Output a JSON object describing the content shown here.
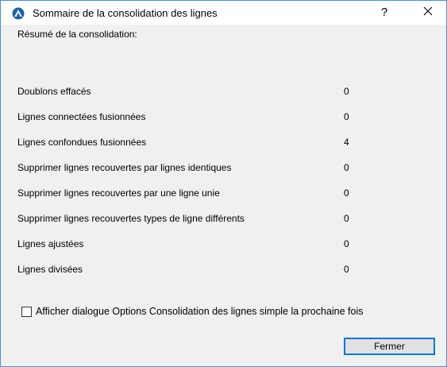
{
  "window": {
    "title": "Sommaire de la consolidation des lignes",
    "help_label": "?",
    "icon": "archicad-icon"
  },
  "summary": {
    "heading": "Résumé de la consolidation:",
    "rows": [
      {
        "label": "Doublons effacés",
        "value": "0"
      },
      {
        "label": "Lignes connectées fusionnées",
        "value": "0"
      },
      {
        "label": "Lignes confondues fusionnées",
        "value": "4"
      },
      {
        "label": "Supprimer lignes recouvertes par lignes identiques",
        "value": "0"
      },
      {
        "label": "Supprimer lignes recouvertes par une ligne unie",
        "value": "0"
      },
      {
        "label": "Supprimer lignes recouvertes types de ligne différents",
        "value": "0"
      },
      {
        "label": "Lignes ajustées",
        "value": "0"
      },
      {
        "label": "Lignes divisées",
        "value": "0"
      }
    ]
  },
  "options": {
    "show_dialog_label": "Afficher dialogue Options Consolidation des lignes simple la prochaine fois",
    "show_dialog_checked": false
  },
  "buttons": {
    "close_label": "Fermer"
  },
  "colors": {
    "accent": "#0078d7",
    "window_border": "#4a8fd8",
    "background": "#f0f0f0"
  }
}
